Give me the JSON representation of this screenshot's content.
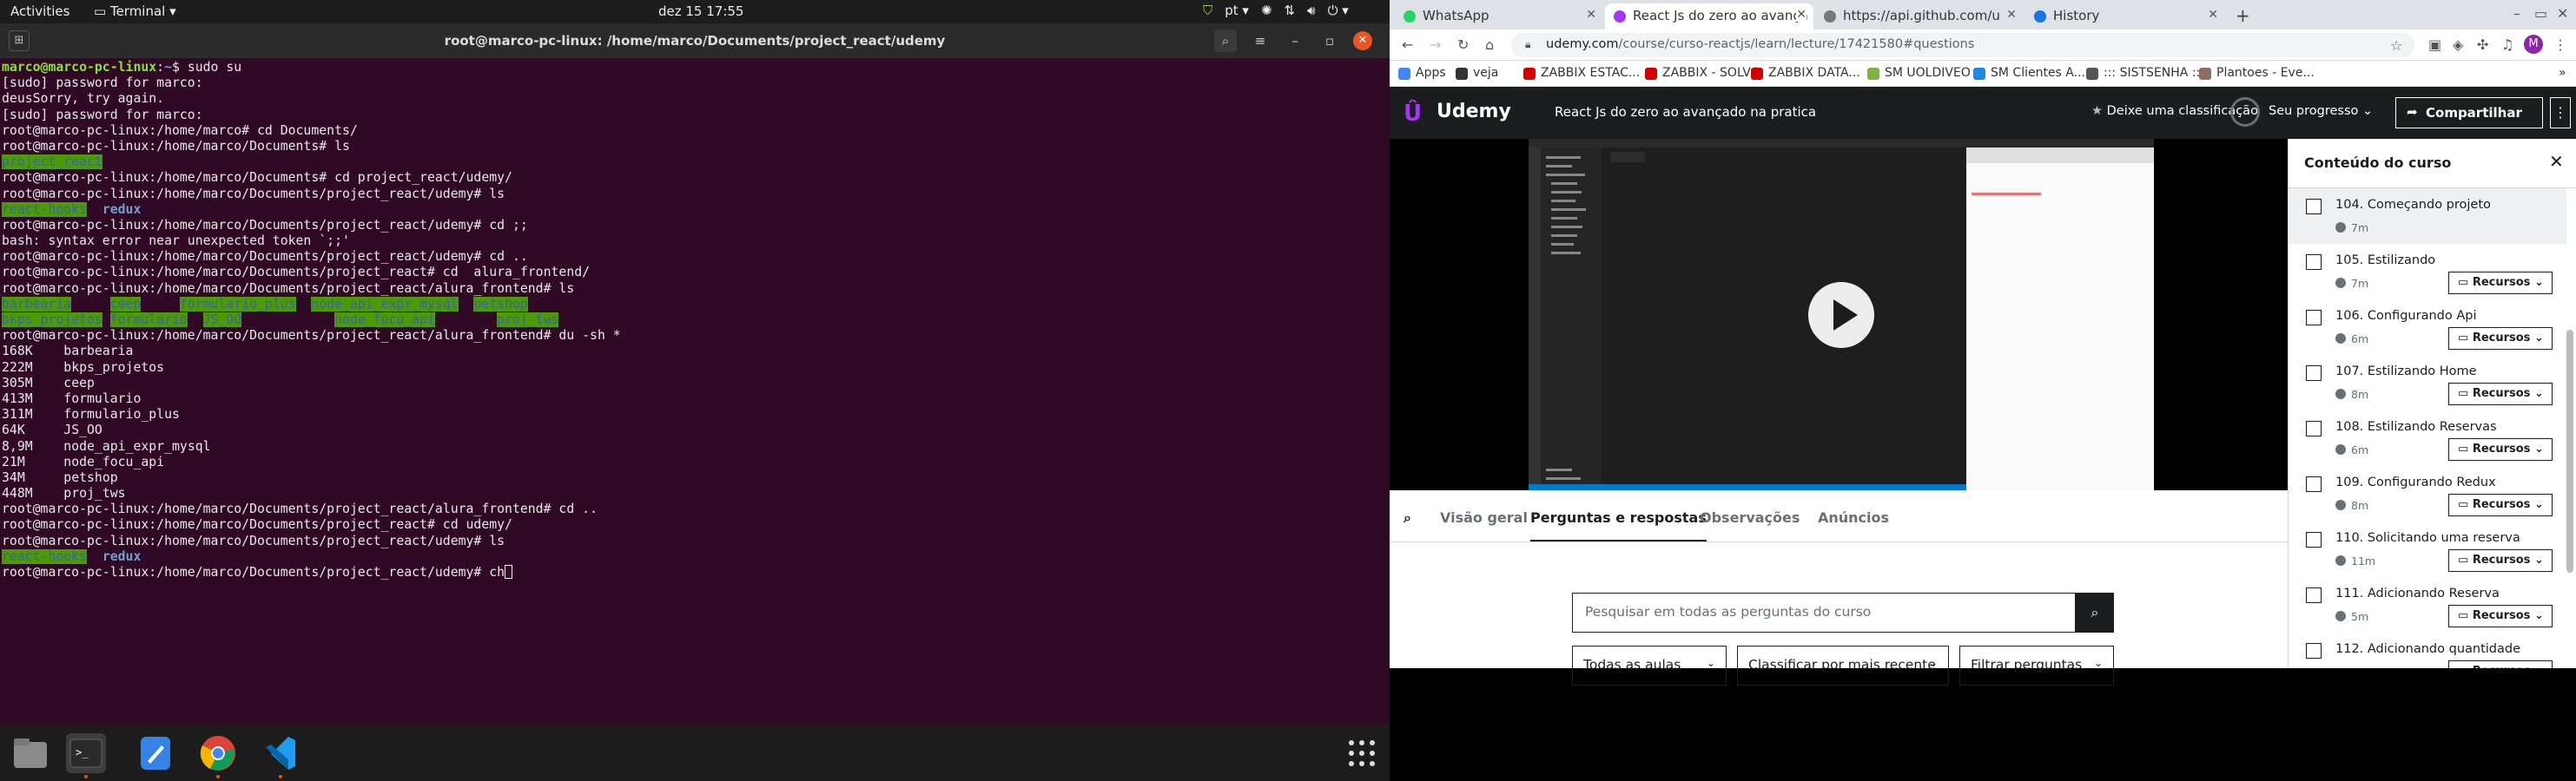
{
  "topbar": {
    "activities": "Activities",
    "app": "Terminal ▾",
    "clock": "dez 15  17:55",
    "lang": "pt ▾"
  },
  "terminal": {
    "title": "root@marco-pc-linux: /home/marco/Documents/project_react/udemy",
    "lines": [
      [
        {
          "t": "marco@marco-pc-linux",
          "c": "p-user"
        },
        {
          "t": ":"
        },
        {
          "t": "~",
          "c": "p-path"
        },
        {
          "t": "$ sudo su"
        }
      ],
      [
        {
          "t": "[sudo] password for marco:"
        }
      ],
      [
        {
          "t": "deusSorry, try again."
        }
      ],
      [
        {
          "t": "[sudo] password for marco:"
        }
      ],
      [
        {
          "t": "root@marco-pc-linux:/home/marco# cd Documents/"
        }
      ],
      [
        {
          "t": "root@marco-pc-linux:/home/marco/Documents# ls"
        }
      ],
      [
        {
          "t": "project_react",
          "c": "dir-g"
        }
      ],
      [
        {
          "t": "root@marco-pc-linux:/home/marco/Documents# cd project_react/udemy/"
        }
      ],
      [
        {
          "t": "root@marco-pc-linux:/home/marco/Documents/project_react/udemy# ls"
        }
      ],
      [
        {
          "t": "react-hooks",
          "c": "dir-g"
        },
        {
          "t": "  "
        },
        {
          "t": "redux",
          "c": "dir-b"
        }
      ],
      [
        {
          "t": "root@marco-pc-linux:/home/marco/Documents/project_react/udemy# cd ;;"
        }
      ],
      [
        {
          "t": "bash: syntax error near unexpected token `;;'"
        }
      ],
      [
        {
          "t": "root@marco-pc-linux:/home/marco/Documents/project_react/udemy# cd .."
        }
      ],
      [
        {
          "t": "root@marco-pc-linux:/home/marco/Documents/project_react# cd  alura_frontend/"
        }
      ],
      [
        {
          "t": "root@marco-pc-linux:/home/marco/Documents/project_react/alura_frontend# ls"
        }
      ],
      [
        {
          "t": "barbearia",
          "c": "dir-g"
        },
        {
          "t": "     "
        },
        {
          "t": "ceep",
          "c": "dir-g"
        },
        {
          "t": "     "
        },
        {
          "t": "formulario_plus",
          "c": "dir-g"
        },
        {
          "t": "  "
        },
        {
          "t": "node_api_expr_mysql",
          "c": "dir-g"
        },
        {
          "t": "  "
        },
        {
          "t": "petshop",
          "c": "dir-g"
        }
      ],
      [
        {
          "t": "bkps_projetos",
          "c": "dir-g"
        },
        {
          "t": " "
        },
        {
          "t": "formulario",
          "c": "dir-g"
        },
        {
          "t": "  "
        },
        {
          "t": "JS_OO",
          "c": "dir-g"
        },
        {
          "t": "            "
        },
        {
          "t": "node_focu_api",
          "c": "dir-g"
        },
        {
          "t": "        "
        },
        {
          "t": "proj_tws",
          "c": "dir-g"
        }
      ],
      [
        {
          "t": "root@marco-pc-linux:/home/marco/Documents/project_react/alura_frontend# du -sh *"
        }
      ],
      [
        {
          "t": "168K\tbarbearia"
        }
      ],
      [
        {
          "t": "222M\tbkps_projetos"
        }
      ],
      [
        {
          "t": "305M\tceep"
        }
      ],
      [
        {
          "t": "413M\tformulario"
        }
      ],
      [
        {
          "t": "311M\tformulario_plus"
        }
      ],
      [
        {
          "t": "64K\tJS_OO"
        }
      ],
      [
        {
          "t": "8,9M\tnode_api_expr_mysql"
        }
      ],
      [
        {
          "t": "21M\tnode_focu_api"
        }
      ],
      [
        {
          "t": "34M\tpetshop"
        }
      ],
      [
        {
          "t": "448M\tproj_tws"
        }
      ],
      [
        {
          "t": "root@marco-pc-linux:/home/marco/Documents/project_react/alura_frontend# cd .."
        }
      ],
      [
        {
          "t": "root@marco-pc-linux:/home/marco/Documents/project_react# cd udemy/"
        }
      ],
      [
        {
          "t": "root@marco-pc-linux:/home/marco/Documents/project_react/udemy# ls"
        }
      ],
      [
        {
          "t": "react-hooks",
          "c": "dir-g"
        },
        {
          "t": "  "
        },
        {
          "t": "redux",
          "c": "dir-b"
        }
      ],
      [
        {
          "t": "root@marco-pc-linux:/home/marco/Documents/project_react/udemy# ch"
        },
        {
          "t": "",
          "c": "cursor"
        }
      ]
    ]
  },
  "browser": {
    "tabs": [
      {
        "label": "WhatsApp",
        "color": "#25d366"
      },
      {
        "label": "React Js do zero ao avança",
        "color": "#a435f0"
      },
      {
        "label": "https://api.github.com/u",
        "color": "#333333"
      },
      {
        "label": "History",
        "color": "#1a73e8"
      }
    ],
    "url_host": "udemy.com",
    "url_path": "/course/curso-reactjs/learn/lecture/17421580#questions",
    "bookmarks": [
      {
        "label": "Apps",
        "color": "#4285f4"
      },
      {
        "label": "veja",
        "color": "#333333"
      },
      {
        "label": "ZABBIX ESTAC...",
        "color": "#d40000"
      },
      {
        "label": "ZABBIX - SOLVO",
        "color": "#d40000"
      },
      {
        "label": "ZABBIX DATA...",
        "color": "#d40000"
      },
      {
        "label": "SM UOLDIVEO",
        "color": "#7cb342"
      },
      {
        "label": "SM Clientes A...",
        "color": "#1e88e5"
      },
      {
        "label": "::: SISTSENHA :::",
        "color": "#555555"
      },
      {
        "label": "Plantoes - Eve...",
        "color": "#8d6e63"
      }
    ]
  },
  "udemy": {
    "logo": "Udemy",
    "course_title": "React Js do zero ao avançado na pratica",
    "rate": "Deixe uma classificação",
    "progress": "Seu progresso",
    "share": "Compartilhar",
    "tabs": [
      "Visão geral",
      "Perguntas e respostas",
      "Observações",
      "Anúncios"
    ],
    "search_placeholder": "Pesquisar em todas as perguntas do curso",
    "filters": [
      "Todas as aulas",
      "Classificar por mais recente",
      "Filtrar perguntas"
    ],
    "sidebar_title": "Conteúdo do curso",
    "resources_label": "Recursos",
    "lessons": [
      {
        "title": "104. Começando projeto",
        "dur": "7m",
        "res": false,
        "current": true
      },
      {
        "title": "105. Estilizando",
        "dur": "7m",
        "res": true
      },
      {
        "title": "106. Configurando Api",
        "dur": "6m",
        "res": true
      },
      {
        "title": "107. Estilizando Home",
        "dur": "8m",
        "res": true
      },
      {
        "title": "108. Estilizando Reservas",
        "dur": "6m",
        "res": true
      },
      {
        "title": "109. Configurando Redux",
        "dur": "8m",
        "res": true
      },
      {
        "title": "110. Solicitando uma reserva",
        "dur": "11m",
        "res": true
      },
      {
        "title": "111. Adicionando Reserva",
        "dur": "5m",
        "res": true
      },
      {
        "title": "112. Adicionando quantidade",
        "dur": "",
        "res": true
      }
    ]
  }
}
